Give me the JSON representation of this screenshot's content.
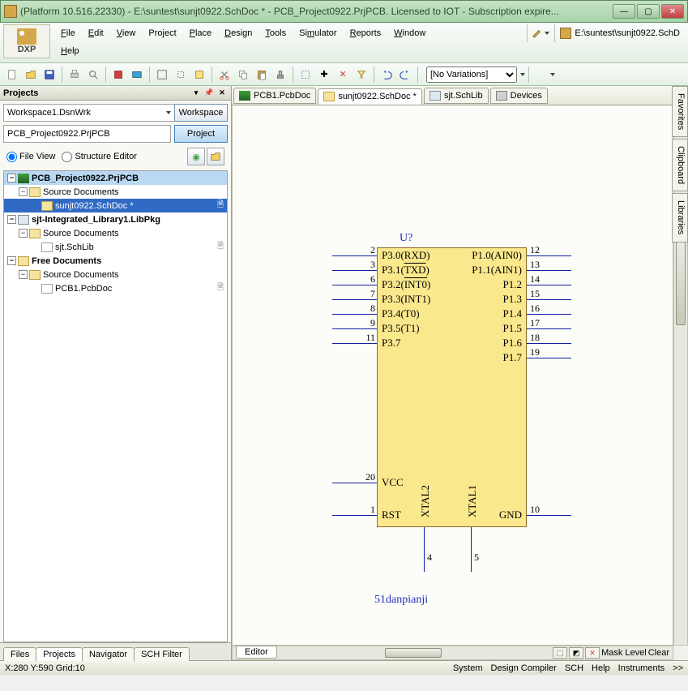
{
  "titlebar": {
    "text": "(Platform 10.516.22330) - E:\\suntest\\sunjt0922.SchDoc * - PCB_Project0922.PrjPCB. Licensed to IOT - Subscription expire..."
  },
  "menubar": {
    "dxp_label": "DXP",
    "items_row1": [
      "File",
      "Edit",
      "View",
      "Project",
      "Place",
      "Design",
      "Tools",
      "Simulator",
      "Reports",
      "Window"
    ],
    "items_row2": [
      "Help"
    ],
    "path_text": "E:\\suntest\\sunjt0922.SchD"
  },
  "toolbar": {
    "variations_selected": "[No Variations]"
  },
  "panel": {
    "title": "Projects",
    "workspace_value": "Workspace1.DsnWrk",
    "workspace_btn": "Workspace",
    "project_value": "PCB_Project0922.PrjPCB",
    "project_btn": "Project",
    "radio_file": "File View",
    "radio_struct": "Structure Editor",
    "tree": {
      "root1": "PCB_Project0922.PrjPCB",
      "src1": "Source Documents",
      "doc1": "sunjt0922.SchDoc *",
      "root2": "sjt-Integrated_Library1.LibPkg",
      "src2": "Source Documents",
      "doc2": "sjt.SchLib",
      "free": "Free Documents",
      "src3": "Source Documents",
      "doc3": "PCB1.PcbDoc"
    },
    "tabs": [
      "Files",
      "Projects",
      "Navigator",
      "SCH Filter"
    ]
  },
  "doctabs": {
    "t1": "PCB1.PcbDoc",
    "t2": "sunjt0922.SchDoc *",
    "t3": "sjt.SchLib",
    "t4": "Devices"
  },
  "schematic": {
    "designator": "U?",
    "partname": "51danpianji",
    "left_pins": [
      {
        "num": "2",
        "name": "P3.0(RXD)"
      },
      {
        "num": "3",
        "name": "P3.1(<ov>TXD</ov>)"
      },
      {
        "num": "6",
        "name": "P3.2(<ov>INT0</ov>)"
      },
      {
        "num": "7",
        "name": "P3.3(INT1)"
      },
      {
        "num": "8",
        "name": "P3.4(T0)"
      },
      {
        "num": "9",
        "name": "P3.5(T1)"
      },
      {
        "num": "11",
        "name": "P3.7"
      }
    ],
    "right_pins": [
      {
        "num": "12",
        "name": "P1.0(AIN0)"
      },
      {
        "num": "13",
        "name": "P1.1(AIN1)"
      },
      {
        "num": "14",
        "name": "P1.2"
      },
      {
        "num": "15",
        "name": "P1.3"
      },
      {
        "num": "16",
        "name": "P1.4"
      },
      {
        "num": "17",
        "name": "P1.5"
      },
      {
        "num": "18",
        "name": "P1.6"
      },
      {
        "num": "19",
        "name": "P1.7"
      }
    ],
    "bl_top": {
      "num": "20",
      "name": "VCC"
    },
    "bl_bot": {
      "num": "1",
      "name": "RST"
    },
    "br": {
      "num": "10",
      "name": "GND"
    },
    "bottom_pins": [
      {
        "num": "4",
        "name": "XTAL2"
      },
      {
        "num": "5",
        "name": "XTAL1"
      }
    ]
  },
  "side_rail": [
    "Favorites",
    "Clipboard",
    "Libraries"
  ],
  "bottom_editor_tab": "Editor",
  "bottom_right_btns": {
    "mask": "Mask Level",
    "clear": "Clear"
  },
  "status": {
    "coords": "X:280 Y:590   Grid:10",
    "right": [
      "System",
      "Design Compiler",
      "SCH",
      "Help",
      "Instruments",
      ">>"
    ]
  }
}
